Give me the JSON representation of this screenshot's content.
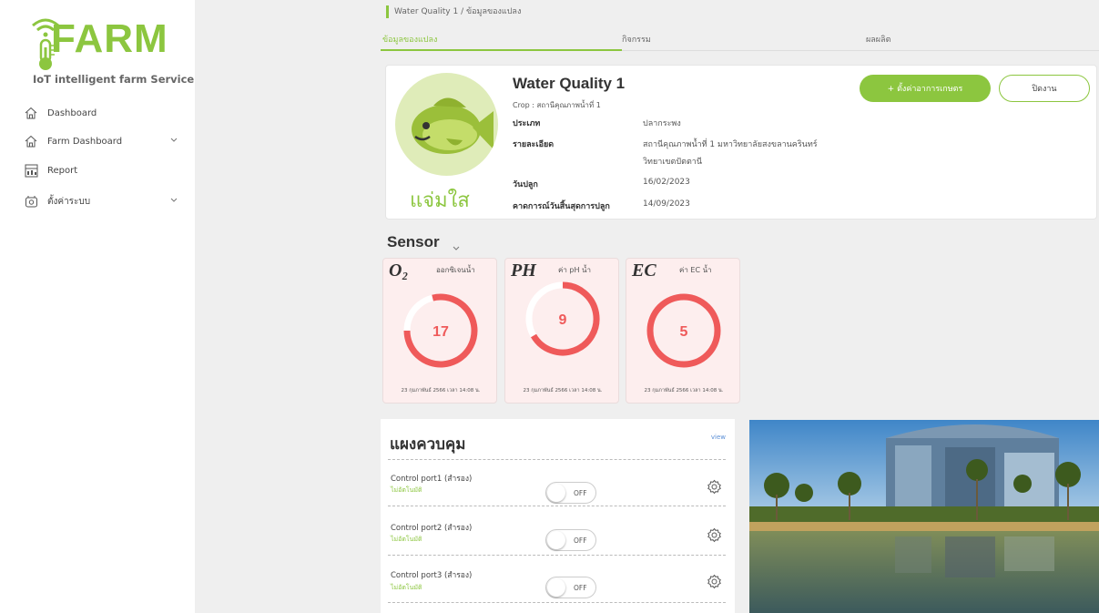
{
  "brand": {
    "logo_text": "FARM",
    "subtitle": "IoT intelligent farm Service"
  },
  "sidebar": {
    "items": [
      {
        "label": "Dashboard",
        "icon": "home-icon"
      },
      {
        "label": "Farm Dashboard",
        "icon": "home-icon",
        "has_submenu": true
      },
      {
        "label": "Report",
        "icon": "report-icon"
      },
      {
        "label": "ตั้งค่าระบบ",
        "icon": "settings-icon",
        "has_submenu": true
      }
    ]
  },
  "breadcrumb": "Water Quality 1 / ข้อมูลของแปลง",
  "tabs": [
    {
      "label": "ข้อมูลของแปลง",
      "active": true
    },
    {
      "label": "กิจกรรม",
      "active": false
    },
    {
      "label": "ผลผลิต",
      "active": false
    }
  ],
  "plot": {
    "title": "Water Quality 1",
    "crop": "Crop : สถานีคุณภาพน้ำที่ 1",
    "image_caption": "แจ่มใส",
    "fields": [
      {
        "label": "ประเภท",
        "value": "ปลากระพง"
      },
      {
        "label": "รายละเอียด",
        "value": "สถานีคุณภาพน้ำที่ 1 มหาวิทยาลัยสงขลานครินทร์",
        "value2": "วิทยาเขตปัตตานี"
      },
      {
        "label": "วันปลูก",
        "value": "16/02/2023"
      },
      {
        "label": "คาดการณ์วันสิ้นสุดการปลูก",
        "value": "14/09/2023"
      }
    ],
    "primary_button": "+ ตั้งค่าอาการเกษตร",
    "close_button": "ปิดงาน"
  },
  "sensor": {
    "title": "Sensor",
    "cards": [
      {
        "symbol": "O₂",
        "name": "ออกซิเจนน้ำ",
        "value": "17",
        "timestamp": "23 กุมภาพันธ์ 2566 เวลา 14:08 น."
      },
      {
        "symbol": "PH",
        "name": "ค่า pH น้ำ",
        "value": "9",
        "timestamp": "23 กุมภาพันธ์ 2566 เวลา 14:08 น."
      },
      {
        "symbol": "EC",
        "name": "ค่า EC น้ำ",
        "value": "5",
        "timestamp": "23 กุมภาพันธ์ 2566 เวลา 14:08 น."
      }
    ],
    "gauge_color": "#ef5a5a",
    "card_bg": "#fdeeee"
  },
  "control_panel": {
    "title": "แผงควบคุม",
    "view_link": "view",
    "ports": [
      {
        "name": "Control port1 (สำรอง)",
        "status": "ไม่อัตโนมัติ",
        "toggle": "OFF"
      },
      {
        "name": "Control port2 (สำรอง)",
        "status": "ไม่อัตโนมัติ",
        "toggle": "OFF"
      },
      {
        "name": "Control port3 (สำรอง)",
        "status": "ไม่อัตโนมัติ",
        "toggle": "OFF"
      }
    ]
  },
  "colors": {
    "accent": "#8cc63f",
    "danger": "#ef5a5a",
    "background": "#efefef"
  }
}
